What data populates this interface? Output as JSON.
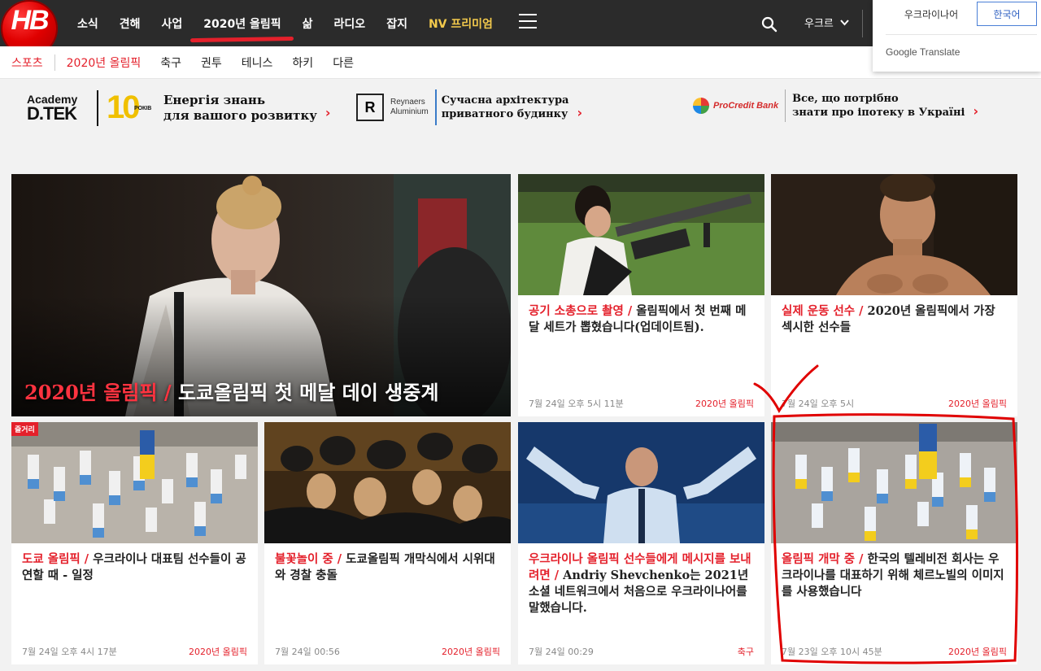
{
  "header": {
    "logo_text": "HB",
    "nav": [
      "소식",
      "견해",
      "사업",
      "2020년 올림픽",
      "삶",
      "라디오",
      "잡지",
      "NV 프리미엄"
    ],
    "active_nav": "2020년 올림픽",
    "lang_label": "우크르"
  },
  "translate": {
    "option_ukrainian": "우크라이나어",
    "option_korean": "한국어",
    "brand": "Google Translate"
  },
  "subnav": {
    "section": "스포츠",
    "items": [
      "2020년 올림픽",
      "축구",
      "권투",
      "테니스",
      "하키",
      "다른"
    ],
    "current": "2020년 올림픽"
  },
  "ads": {
    "dtek": {
      "logo_line1": "Academy",
      "logo_line2": "D.TEK",
      "ten_badge": "10",
      "ten_caption": "РОКІВ",
      "text_line1": "Енергія знань",
      "text_line2": "для вашого розвитку"
    },
    "reynaers": {
      "mark": "R",
      "name_line1": "Reynaers",
      "name_line2": "Aluminium",
      "text_line1": "Сучасна архітектура",
      "text_line2": "приватного будинку"
    },
    "procredit": {
      "name": "ProCredit Bank",
      "text_line1": "Все, що потрібно",
      "text_line2": "знати про іпотеку в Україні"
    },
    "arrow": "›"
  },
  "hero": {
    "rubric": "2020년 올림픽 /",
    "title": " 도쿄올림픽 첫 메달 데이 생중계"
  },
  "cards": [
    {
      "rubric": "공기 소총으로 촬영 /",
      "title": " 올림픽에서 첫 번째 메달 세트가 뽑혔습니다(업데이트됨).",
      "time": "7월 24일 오후 5시 11분",
      "tag": "2020년 올림픽"
    },
    {
      "rubric": "실제 운동 선수 /",
      "title": " 2020년 올림픽에서 가장 섹시한 선수들",
      "time": "7월 24일 오후 5시",
      "tag": "2020년 올림픽"
    },
    {
      "badge": "즐거리",
      "rubric": "도쿄 올림픽 /",
      "title": " 우크라이나 대표팀 선수들이 공연할 때 - 일정",
      "time": "7월 24일 오후 4시 17분",
      "tag": "2020년 올림픽"
    },
    {
      "rubric": "불꽃놀이 중 /",
      "title": " 도쿄올림픽 개막식에서 시위대와 경찰 충돌",
      "time": "7월 24일 00:56",
      "tag": "2020년 올림픽"
    },
    {
      "rubric": "우크라이나 올림픽 선수들에게 메시지를 보내려면 /",
      "title": " Andriy Shevchenko는 2021년 소셜 네트워크에서 처음으로 우크라이나어를 말했습니다.",
      "time": "7월 24일 00:29",
      "tag": "축구"
    },
    {
      "rubric": "올림픽 개막 중 /",
      "title": " 한국의 텔레비전 회사는 우크라이나를 대표하기 위해 체르노빌의 이미지를 사용했습니다",
      "time": "7월 23일 오후 10시 45분",
      "tag": "2020년 올림픽"
    }
  ],
  "colors": {
    "accent": "#e4202b",
    "header_bg": "#2b2b2b",
    "premium": "#f2c94c",
    "annotation": "#e00000"
  }
}
